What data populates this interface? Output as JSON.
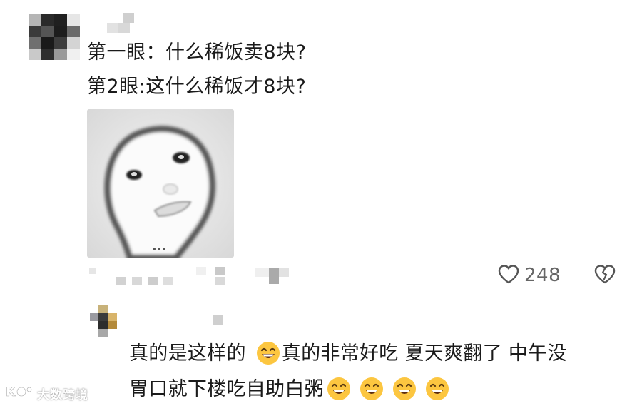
{
  "comment": {
    "line1": "第一眼：什么稀饭卖8块?",
    "line2": "第2眼:这什么稀饭才8块?",
    "image_alt": "meme-face",
    "like_count": "248",
    "icons": {
      "like": "heart-outline-icon",
      "dislike": "broken-heart-icon"
    }
  },
  "reply": {
    "text_part1": "真的是这样的",
    "text_part2": "真的非常好吃 夏天爽翻了 中午没",
    "line2": "胃口就下楼吃自助白粥",
    "emoji": "grinning-face-emoji"
  },
  "watermark": {
    "text": "大数跨境"
  }
}
